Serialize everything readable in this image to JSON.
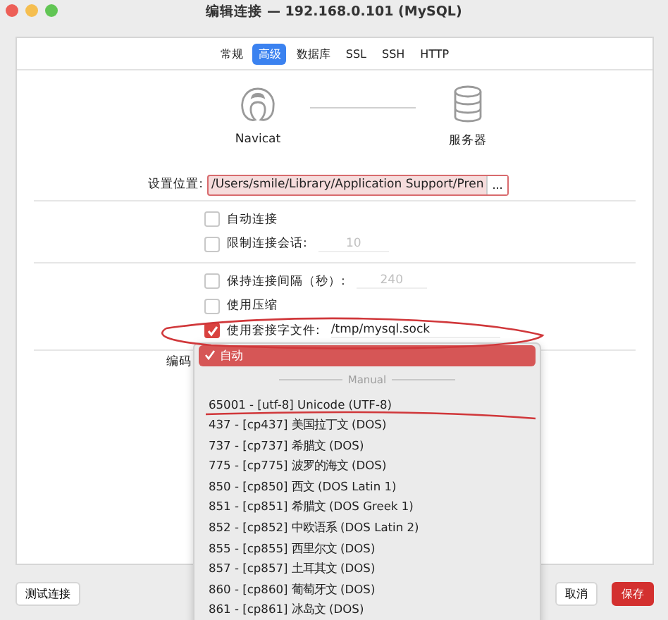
{
  "window": {
    "title": "编辑连接 — 192.168.0.101 (MySQL)"
  },
  "tabs": [
    {
      "label": "常规",
      "selected": false
    },
    {
      "label": "高级",
      "selected": true
    },
    {
      "label": "数据库",
      "selected": false
    },
    {
      "label": "SSL",
      "selected": false
    },
    {
      "label": "SSH",
      "selected": false
    },
    {
      "label": "HTTP",
      "selected": false
    }
  ],
  "diagram": {
    "client_label": "Navicat",
    "server_label": "服务器"
  },
  "settings_location": {
    "label": "设置位置:",
    "value": "/Users/smile/Library/Application Support/Pren",
    "browse": "..."
  },
  "option_groups": [
    {
      "options": [
        {
          "label": "自动连接",
          "checked": false
        },
        {
          "label": "限制连接会话:",
          "checked": false,
          "value": "10"
        }
      ]
    },
    {
      "options": [
        {
          "label": "保持连接间隔（秒）:",
          "checked": false,
          "value": "240"
        },
        {
          "label": "使用压缩",
          "checked": false
        },
        {
          "label": "使用套接字文件:",
          "checked": true,
          "value": "/tmp/mysql.sock"
        }
      ]
    }
  ],
  "encoding": {
    "label": "编码",
    "menu": [
      {
        "kind": "option",
        "label": "自动",
        "selected": true
      },
      {
        "kind": "separator",
        "label": "Manual"
      },
      {
        "kind": "option",
        "label": "65001 - [utf-8] Unicode (UTF-8)",
        "selected": false
      },
      {
        "kind": "option",
        "label": "437 - [cp437] 美国拉丁文 (DOS)",
        "selected": false
      },
      {
        "kind": "option",
        "label": "737 - [cp737] 希腊文 (DOS)",
        "selected": false
      },
      {
        "kind": "option",
        "label": "775 - [cp775] 波罗的海文 (DOS)",
        "selected": false
      },
      {
        "kind": "option",
        "label": "850 - [cp850] 西文 (DOS Latin 1)",
        "selected": false
      },
      {
        "kind": "option",
        "label": "851 - [cp851] 希腊文 (DOS Greek 1)",
        "selected": false
      },
      {
        "kind": "option",
        "label": "852 - [cp852] 中欧语系 (DOS Latin 2)",
        "selected": false
      },
      {
        "kind": "option",
        "label": "855 - [cp855] 西里尔文 (DOS)",
        "selected": false
      },
      {
        "kind": "option",
        "label": "857 - [cp857] 土耳其文 (DOS)",
        "selected": false
      },
      {
        "kind": "option",
        "label": "860 - [cp860] 葡萄牙文 (DOS)",
        "selected": false
      },
      {
        "kind": "option",
        "label": "861 - [cp861] 冰岛文 (DOS)",
        "selected": false
      }
    ]
  },
  "left_buttons": [
    {
      "label": "测试连接"
    }
  ],
  "right_buttons": [
    {
      "label": "取消",
      "kind": "secondary"
    },
    {
      "label": "保存",
      "kind": "primary"
    }
  ],
  "annotations": {
    "socket_circled": true,
    "utf8_underlined": true
  }
}
